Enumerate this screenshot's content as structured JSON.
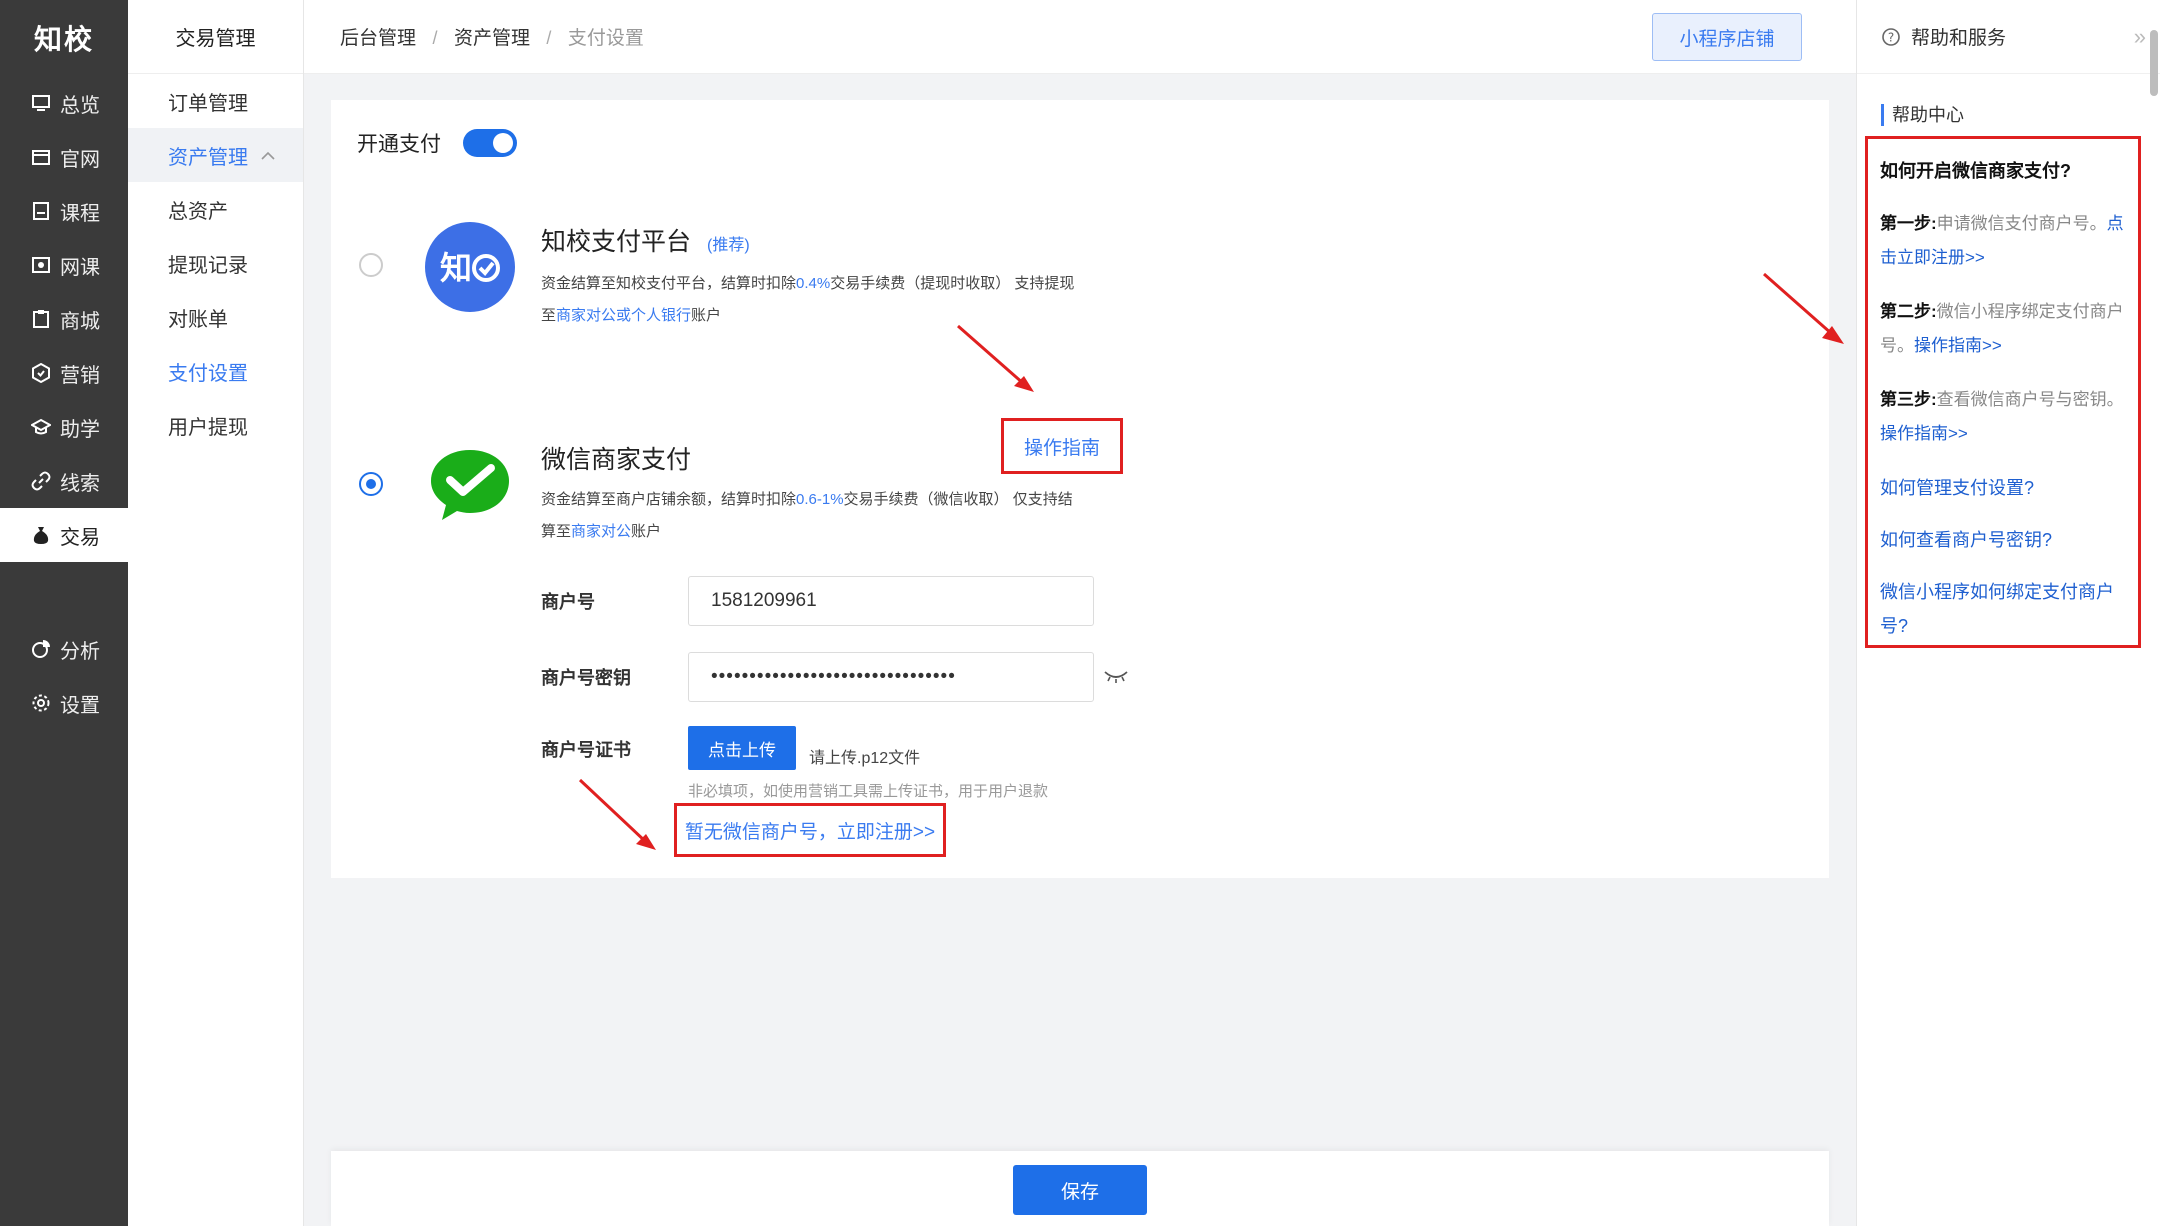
{
  "brand": {
    "logo_text": "知校"
  },
  "nav": {
    "items": [
      {
        "label": "总览",
        "icon": "monitor-icon"
      },
      {
        "label": "官网",
        "icon": "store-icon"
      },
      {
        "label": "课程",
        "icon": "book-icon"
      },
      {
        "label": "网课",
        "icon": "video-icon"
      },
      {
        "label": "商城",
        "icon": "clipboard-icon"
      },
      {
        "label": "营销",
        "icon": "hexagon-icon"
      },
      {
        "label": "助学",
        "icon": "graduation-icon"
      },
      {
        "label": "线索",
        "icon": "link-icon"
      },
      {
        "label": "交易",
        "icon": "money-bag-icon",
        "active": true
      },
      {
        "label": "分析",
        "icon": "analytics-icon"
      },
      {
        "label": "设置",
        "icon": "gear-icon"
      }
    ]
  },
  "subnav": {
    "title": "交易管理",
    "items": [
      "订单管理",
      "资产管理",
      "总资产",
      "提现记录",
      "对账单",
      "支付设置",
      "用户提现"
    ]
  },
  "header": {
    "breadcrumb": [
      "后台管理",
      "资产管理",
      "支付设置"
    ],
    "separator": "/",
    "mini_program_button": "小程序店铺"
  },
  "payment": {
    "enable_label": "开通支付",
    "enabled": true,
    "zhixiao": {
      "title": "知校支付平台",
      "badge": "(推荐)",
      "desc_1": "资金结算至知校支付平台，结算时扣除",
      "fee": "0.4%",
      "desc_2": "交易手续费（提现时收取） 支持提现",
      "desc_3": "至",
      "target": "商家对公或个人银行",
      "desc_4": "账户",
      "selected": false
    },
    "wechat": {
      "title": "微信商家支付",
      "guide_link": "操作指南",
      "desc_1": "资金结算至商户店铺余额，结算时扣除",
      "fee": "0.6-1%",
      "desc_2": "交易手续费（微信收取） 仅支持结",
      "desc_3": "算至",
      "target": "商家对公",
      "desc_4": "账户",
      "selected": true
    },
    "fields": {
      "merchant_id_label": "商户号",
      "merchant_id_value": "1581209961",
      "merchant_key_label": "商户号密钥",
      "merchant_key_value": "••••••••••••••••••••••••••••••••",
      "cert_label": "商户号证书",
      "upload_button": "点击上传",
      "upload_tip": "请上传.p12文件",
      "hint": "非必填项，如使用营销工具需上传证书，用于用户退款",
      "register_link": "暂无微信商户号，立即注册>>"
    },
    "save_button": "保存"
  },
  "help": {
    "title": "帮助和服务",
    "collapse_glyph": "»",
    "center_label": "帮助中心",
    "question": "如何开启微信商家支付?",
    "steps": [
      {
        "head": "第一步:",
        "text": "申请微信支付商户号。",
        "link": "点击立即注册>>"
      },
      {
        "head": "第二步:",
        "text": "微信小程序绑定支付商户号。",
        "link": "操作指南>>"
      },
      {
        "head": "第三步:",
        "text": "查看微信商户号与密钥。",
        "link": "操作指南>>"
      }
    ],
    "links": [
      "如何管理支付设置?",
      "如何查看商户号密钥?",
      "微信小程序如何绑定支付商户号?"
    ]
  },
  "colors": {
    "primary": "#1e6fe8",
    "nav_bg": "#3a3a3a",
    "annotation_red": "#e02020",
    "wechat_green": "#1aad19",
    "zhixiao_blue": "#3d6fe6"
  }
}
